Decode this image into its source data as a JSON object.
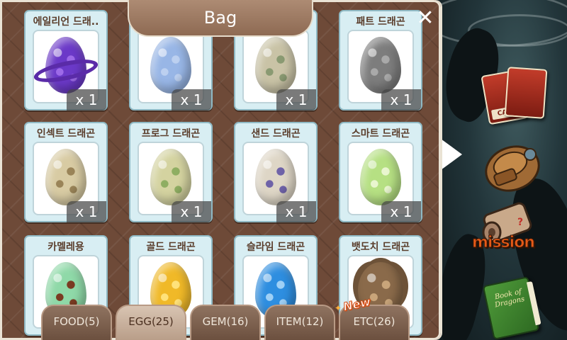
{
  "panel": {
    "title": "Bag",
    "close_glyph": "✕"
  },
  "items": [
    {
      "name": "에일리언 드래..",
      "qty": "x 1",
      "egg": {
        "base": "#6b39c8",
        "spot": "#9d6ae8",
        "ring": true
      }
    },
    {
      "name": "",
      "qty": "x 1",
      "egg": {
        "base": "#98b6e6",
        "spot": "#bcd0f0"
      }
    },
    {
      "name": "",
      "qty": "x 1",
      "egg": {
        "base": "#c9c3a6",
        "spot": "#8a9a72"
      }
    },
    {
      "name": "패트 드래곤",
      "qty": "x 1",
      "egg": {
        "base": "#7d7d7d",
        "spot": "#a9a9a9"
      }
    },
    {
      "name": "인섹트 드래곤",
      "qty": "x 1",
      "egg": {
        "base": "#d8cba3",
        "spot": "#9a8458"
      }
    },
    {
      "name": "프로그 드래곤",
      "qty": "x 1",
      "egg": {
        "base": "#d4d3a0",
        "spot": "#8fae62"
      }
    },
    {
      "name": "샌드 드래곤",
      "qty": "x 1",
      "egg": {
        "base": "#ded6c6",
        "spot": "#6f63a8"
      }
    },
    {
      "name": "스마트 드래곤",
      "qty": "x 1",
      "egg": {
        "base": "#b6e083",
        "spot": "#e9f6cf"
      }
    },
    {
      "name": "카멜레용",
      "qty": "",
      "egg": {
        "base": "#8fd9a8",
        "spot": "#7a3b22"
      }
    },
    {
      "name": "골드 드래곤",
      "qty": "",
      "egg": {
        "base": "#f0b928",
        "spot": "#ffe27a"
      }
    },
    {
      "name": "슬라임 드래곤",
      "qty": "",
      "egg": {
        "base": "#2e8ee0",
        "spot": "#9fd0f6"
      }
    },
    {
      "name": "뱃도치 드래곤",
      "qty": "",
      "egg": {
        "base": "#8a6a4a",
        "spot": "#c9a57a",
        "spiky": true
      }
    }
  ],
  "tabs": [
    {
      "label": "FOOD(5)",
      "active": false
    },
    {
      "label": "EGG(25)",
      "active": true
    },
    {
      "label": "GEM(16)",
      "active": false
    },
    {
      "label": "ITEM(12)",
      "active": false
    },
    {
      "label": "ETC(26)",
      "active": false
    }
  ],
  "badge": {
    "new_label": "New"
  },
  "side": {
    "card_label": "CARD",
    "mission_label": "mission",
    "book_title": "Book of Dragons",
    "icons": [
      "card-icon",
      "backpack-icon",
      "mission-scroll-icon",
      "book-icon"
    ]
  }
}
